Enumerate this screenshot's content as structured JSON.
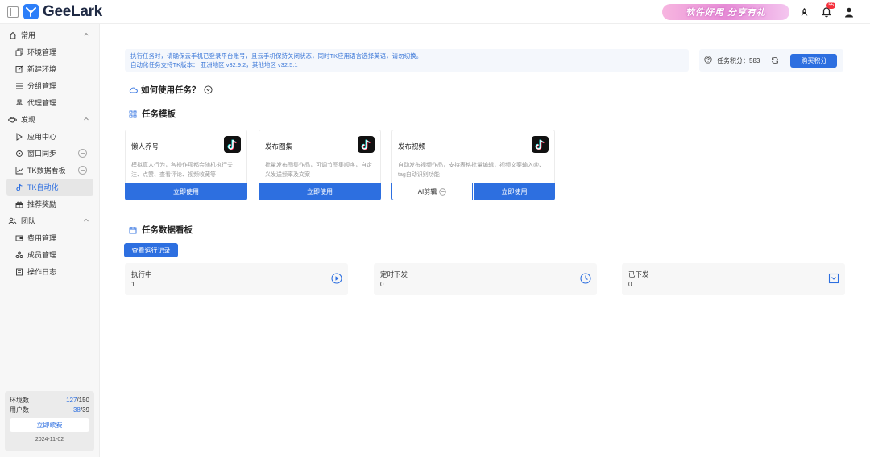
{
  "header": {
    "logo_text": "GeeLark",
    "promo_text": "软件好用 分享有礼",
    "notification_count": "55"
  },
  "sidebar": {
    "groups": [
      {
        "label": "常用",
        "items": [
          "环境管理",
          "新建环境",
          "分组管理",
          "代理管理"
        ]
      },
      {
        "label": "发现",
        "items": [
          "应用中心",
          "窗口同步",
          "TK数据看板",
          "TK自动化",
          "推荐奖励"
        ]
      },
      {
        "label": "团队",
        "items": [
          "费用管理",
          "成员管理",
          "操作日志"
        ]
      }
    ],
    "active_item": "TK自动化",
    "footer": {
      "env_label": "环境数",
      "env_used": "127",
      "env_total": "/150",
      "user_label": "用户数",
      "user_used": "38",
      "user_total": "/39",
      "renew_label": "立即续费",
      "date": "2024-11-02"
    }
  },
  "main": {
    "notice_line1": "执行任务时，请确保云手机已登录平台账号，且云手机保持关闭状态，同时TK应用语言选择英语，请勿切换。",
    "notice_line2": "自动化任务支持TK版本：  亚洲地区 v32.9.2，其他地区 v32.5.1",
    "credits_label": "任务积分：583",
    "buy_label": "购买积分",
    "how_title": "如何使用任务？",
    "templates_title": "任务模板",
    "templates": [
      {
        "title": "懒人养号",
        "desc": "模拟真人行为，各操作项都会随机执行关注、点赞、查看评论、视频收藏等",
        "button": "立即使用"
      },
      {
        "title": "发布图集",
        "desc": "批量发布图集作品，可调节图集顺序，自定义发送频率及文案",
        "button": "立即使用"
      },
      {
        "title": "发布视频",
        "desc": "自动发布视频作品，支持表格批量编辑，视频文案输入@、tag自动识别功能",
        "ai_button": "AI剪辑",
        "button": "立即使用"
      }
    ],
    "dashboard_title": "任务数据看板",
    "log_button": "查看运行记录",
    "stats": [
      {
        "label": "执行中",
        "value": "1",
        "icon": "play-circle-icon"
      },
      {
        "label": "定时下发",
        "value": "0",
        "icon": "clock-icon"
      },
      {
        "label": "已下发",
        "value": "0",
        "icon": "inbox-down-icon"
      }
    ]
  },
  "colors": {
    "accent": "#2d6fe0",
    "brand": "#2d7ff9"
  }
}
